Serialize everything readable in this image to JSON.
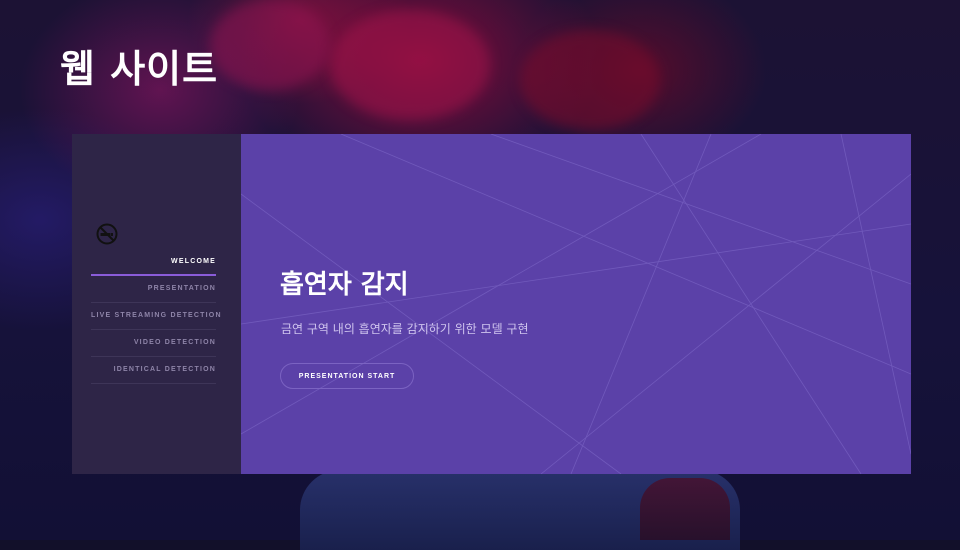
{
  "slide": {
    "title": "웹 사이트"
  },
  "sidebar": {
    "logo_icon": "no-smoking-icon",
    "items": [
      {
        "label": "WELCOME",
        "active": true
      },
      {
        "label": "PRESENTATION",
        "active": false
      },
      {
        "label": "LIVE STREAMING DETECTION",
        "active": false
      },
      {
        "label": "VIDEO DETECTION",
        "active": false
      },
      {
        "label": "IDENTICAL DETECTION",
        "active": false
      }
    ]
  },
  "main": {
    "title": "흡연자 감지",
    "subtitle": "금연 구역 내의 흡연자를 감지하기 위한 모델 구현",
    "cta_label": "PRESENTATION START"
  },
  "colors": {
    "sidebar_bg": "#2e2547",
    "main_bg": "#5b41a8",
    "accent": "#8a5cd9"
  }
}
